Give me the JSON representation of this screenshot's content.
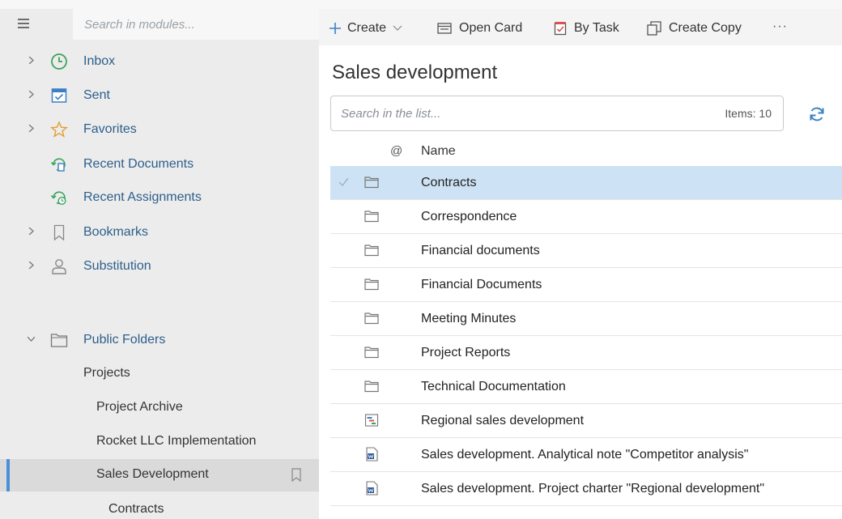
{
  "sidebar": {
    "search_placeholder": "Search in modules...",
    "nav": [
      {
        "label": "Inbox",
        "icon": "clock-icon"
      },
      {
        "label": "Sent",
        "icon": "calendar-check-icon"
      },
      {
        "label": "Favorites",
        "icon": "star-icon"
      },
      {
        "label": "Recent Documents",
        "icon": "recent-documents-icon"
      },
      {
        "label": "Recent Assignments",
        "icon": "recent-assignments-icon"
      },
      {
        "label": "Bookmarks",
        "icon": "bookmark-icon"
      },
      {
        "label": "Substitution",
        "icon": "person-icon"
      }
    ],
    "public_folders": "Public Folders",
    "tree": [
      "Projects",
      "Project Archive",
      "Rocket LLC Implementation",
      "Sales Development",
      "Contracts"
    ]
  },
  "toolbar": {
    "create": "Create",
    "open_card": "Open Card",
    "by_task": "By Task",
    "create_copy": "Create Copy",
    "more": "···"
  },
  "main": {
    "title": "Sales development",
    "search_placeholder": "Search in the list...",
    "items_count": "Items: 10",
    "columns": {
      "at": "@",
      "name": "Name"
    },
    "rows": [
      {
        "name": "Contracts",
        "type": "folder"
      },
      {
        "name": "Correspondence",
        "type": "folder"
      },
      {
        "name": "Financial documents",
        "type": "folder"
      },
      {
        "name": "Financial Documents",
        "type": "folder"
      },
      {
        "name": "Meeting Minutes",
        "type": "folder"
      },
      {
        "name": "Project Reports",
        "type": "folder"
      },
      {
        "name": "Technical Documentation",
        "type": "folder"
      },
      {
        "name": "Regional sales development",
        "type": "gantt"
      },
      {
        "name": "Sales development. Analytical note \"Competitor analysis\"",
        "type": "word"
      },
      {
        "name": "Sales development. Project charter \"Regional development\"",
        "type": "word"
      }
    ]
  },
  "colors": {
    "accent": "#4a90d9",
    "nav_text": "#2d5f8c",
    "selected_row": "#cde3f5",
    "green_icon": "#3aa35c",
    "star": "#e0a030"
  }
}
